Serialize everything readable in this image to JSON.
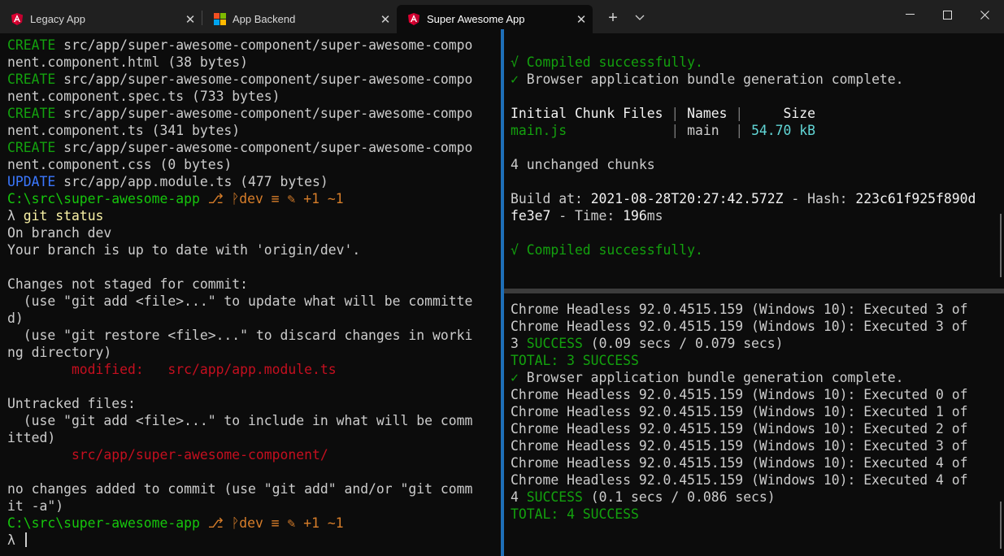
{
  "colors": {
    "titlebar": "#202020",
    "terminal_bg": "#0c0c0c",
    "divider_active": "#1e6fb8",
    "green": "#13a10e",
    "blue": "#3b78ff",
    "red": "#c50f1f",
    "orange": "#d87e2a",
    "cyan": "#61d6d6"
  },
  "tabs": [
    {
      "label": "Legacy App",
      "icon": "angular-icon",
      "close": "✕"
    },
    {
      "label": "App Backend",
      "icon": "windows-icon",
      "close": "✕"
    },
    {
      "label": "Super Awesome App",
      "icon": "angular-icon",
      "close": "✕",
      "active": true
    }
  ],
  "tabbar": {
    "new_tab": "+",
    "dropdown": "chevron-down-icon"
  },
  "window": {
    "minimize": "minimize-icon",
    "maximize": "maximize-icon",
    "close": "close-icon"
  },
  "left_pane": {
    "lines": [
      {
        "tag": "CREATE",
        "text": " src/app/super-awesome-component/super-awesome-compo"
      },
      {
        "text": "nent.component.html (38 bytes)"
      },
      {
        "tag": "CREATE",
        "text": " src/app/super-awesome-component/super-awesome-compo"
      },
      {
        "text": "nent.component.spec.ts (733 bytes)"
      },
      {
        "tag": "CREATE",
        "text": " src/app/super-awesome-component/super-awesome-compo"
      },
      {
        "text": "nent.component.ts (341 bytes)"
      },
      {
        "tag": "CREATE",
        "text": " src/app/super-awesome-component/super-awesome-compo"
      },
      {
        "text": "nent.component.css (0 bytes)"
      },
      {
        "tag": "UPDATE",
        "text": " src/app/app.module.ts (477 bytes)"
      },
      {
        "prompt": true,
        "path": "C:\\src\\super-awesome-app",
        "git": " ⎇ ᚹdev ≡ ✎ +1 ~1"
      },
      {
        "lambda": "λ ",
        "cmd": "git status"
      },
      {
        "text": "On branch dev"
      },
      {
        "text": "Your branch is up to date with 'origin/dev'."
      },
      {
        "text": ""
      },
      {
        "text": "Changes not staged for commit:"
      },
      {
        "text": "  (use \"git add <file>...\" to update what will be committe"
      },
      {
        "text": "d)"
      },
      {
        "text": "  (use \"git restore <file>...\" to discard changes in worki"
      },
      {
        "text": "ng directory)"
      },
      {
        "red": "        modified:   src/app/app.module.ts"
      },
      {
        "text": ""
      },
      {
        "text": "Untracked files:"
      },
      {
        "text": "  (use \"git add <file>...\" to include in what will be comm"
      },
      {
        "text": "itted)"
      },
      {
        "red": "        src/app/super-awesome-component/"
      },
      {
        "text": ""
      },
      {
        "text": "no changes added to commit (use \"git add\" and/or \"git comm"
      },
      {
        "text": "it -a\")"
      },
      {
        "prompt": true,
        "path": "C:\\src\\super-awesome-app",
        "git": " ⎇ ᚹdev ≡ ✎ +1 ~1"
      },
      {
        "lambda": "λ ",
        "cursor": true
      }
    ]
  },
  "top_right_pane": {
    "lines": [
      {
        "text": ""
      },
      {
        "green": "√ Compiled successfully."
      },
      {
        "green_mark": "✓",
        "text": " Browser application bundle generation complete."
      },
      {
        "text": ""
      },
      {
        "table_header": true,
        "c1": "Initial Chunk Files",
        "sep": " | ",
        "c2": "Names",
        "sep2": " | ",
        "c3": "    Size"
      },
      {
        "table_row": true,
        "c1": "main.js            ",
        "sep": " | ",
        "c2": "main ",
        "sep2": " | ",
        "c3": "54.70 kB"
      },
      {
        "text": ""
      },
      {
        "text": "4 unchanged chunks"
      },
      {
        "text": ""
      },
      {
        "build": true,
        "label1": "Build at: ",
        "date": "2021-08-28T20:27:42.572Z",
        "label2": " - Hash: ",
        "hash": "223c61f925f890d"
      },
      {
        "build2": true,
        "hash": "fe3e7",
        "label3": " - Time: ",
        "time": "196",
        "unit": "ms"
      },
      {
        "text": ""
      },
      {
        "green": "√ Compiled successfully."
      }
    ]
  },
  "bottom_right_pane": {
    "lines": [
      {
        "text": "Chrome Headless 92.0.4515.159 (Windows 10): Executed 3 of"
      },
      {
        "text": "Chrome Headless 92.0.4515.159 (Windows 10): Executed 3 of"
      },
      {
        "pre": "3 ",
        "success": "SUCCESS",
        "post": " (0.09 secs / 0.079 secs)"
      },
      {
        "green": "TOTAL: 3 SUCCESS"
      },
      {
        "green_mark": "✓",
        "text": " Browser application bundle generation complete."
      },
      {
        "text": "Chrome Headless 92.0.4515.159 (Windows 10): Executed 0 of"
      },
      {
        "text": "Chrome Headless 92.0.4515.159 (Windows 10): Executed 1 of"
      },
      {
        "text": "Chrome Headless 92.0.4515.159 (Windows 10): Executed 2 of"
      },
      {
        "text": "Chrome Headless 92.0.4515.159 (Windows 10): Executed 3 of"
      },
      {
        "text": "Chrome Headless 92.0.4515.159 (Windows 10): Executed 4 of"
      },
      {
        "text": "Chrome Headless 92.0.4515.159 (Windows 10): Executed 4 of"
      },
      {
        "pre": "4 ",
        "success": "SUCCESS",
        "post": " (0.1 secs / 0.086 secs)"
      },
      {
        "green": "TOTAL: 4 SUCCESS"
      }
    ]
  }
}
